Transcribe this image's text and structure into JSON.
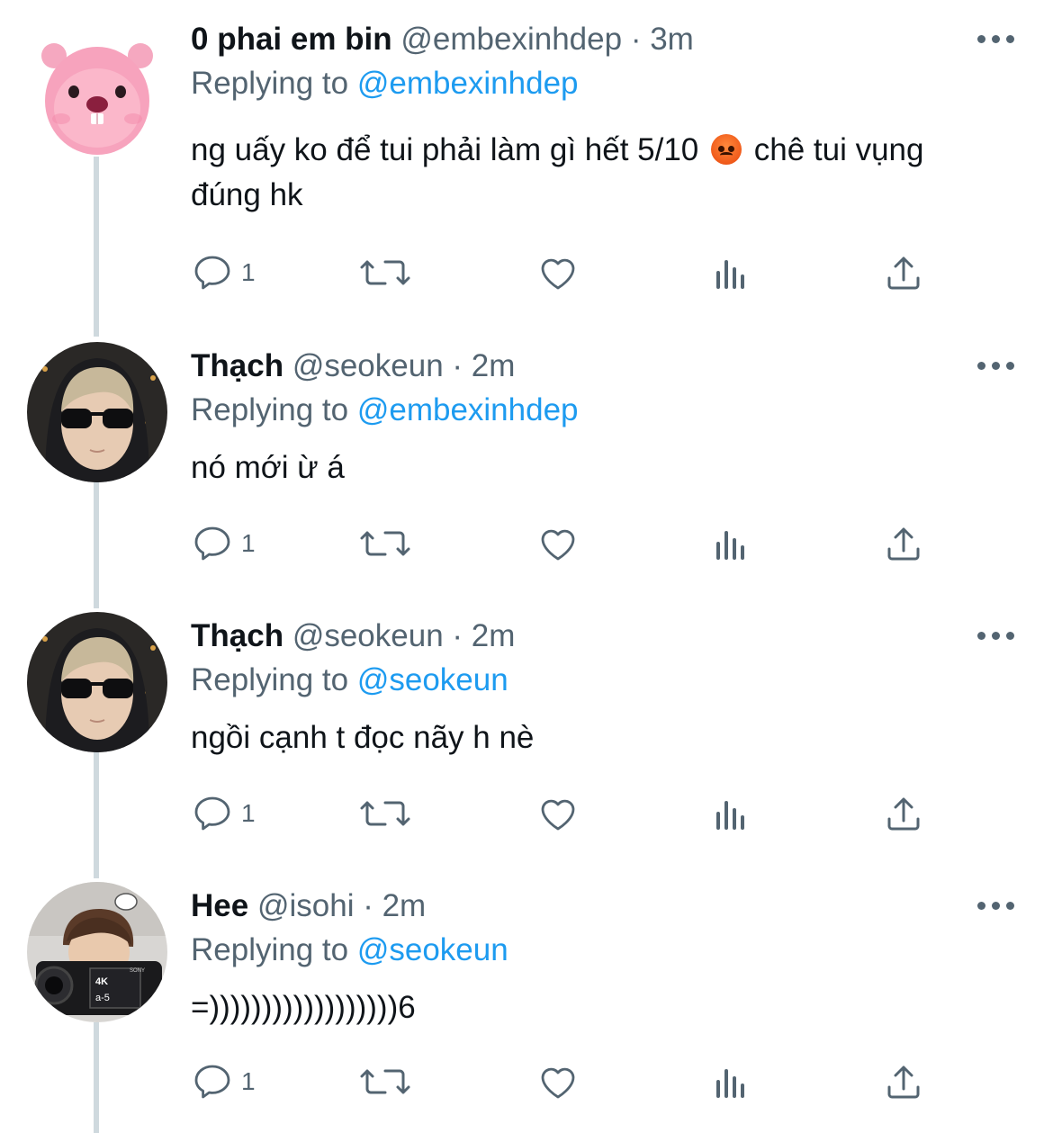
{
  "tweets": [
    {
      "name": "0 phai em bin",
      "handle": "@embexinhdep",
      "time": "· 3m",
      "replying_prefix": "Replying to ",
      "replying_to": "@embexinhdep",
      "text_before_emoji": "ng uấy ko để tui phải làm gì hết 5/10 ",
      "emoji": "angry-face-emoji",
      "text_after_emoji": " chê tui vụng đúng hk",
      "reply_count": "1",
      "avatar": "pink-beaver-avatar"
    },
    {
      "name": "Thạch",
      "handle": "@seokeun",
      "time": "· 2m",
      "replying_prefix": "Replying to ",
      "replying_to": "@embexinhdep",
      "text": "nó mới ừ á",
      "reply_count": "1",
      "avatar": "sunglasses-hoodie-avatar"
    },
    {
      "name": "Thạch",
      "handle": "@seokeun",
      "time": "· 2m",
      "replying_prefix": "Replying to ",
      "replying_to": "@seokeun",
      "text": "ngồi cạnh t đọc nãy h nè",
      "reply_count": "1",
      "avatar": "sunglasses-hoodie-avatar"
    },
    {
      "name": "Hee",
      "handle": "@isohi",
      "time": "· 2m",
      "replying_prefix": "Replying to ",
      "replying_to": "@seokeun",
      "text": "=))))))))))))))))))6",
      "reply_count": "1",
      "avatar": "camera-person-avatar",
      "camera_labels": {
        "brand": "SONY",
        "res": "4K",
        "model": "a-5"
      }
    }
  ],
  "icons": [
    "reply-icon",
    "retweet-icon",
    "like-icon",
    "views-icon",
    "share-icon",
    "more-icon"
  ],
  "colors": {
    "accent": "#1d9bf0",
    "muted": "#536471",
    "text": "#0f1419",
    "line": "#cfd9de"
  }
}
